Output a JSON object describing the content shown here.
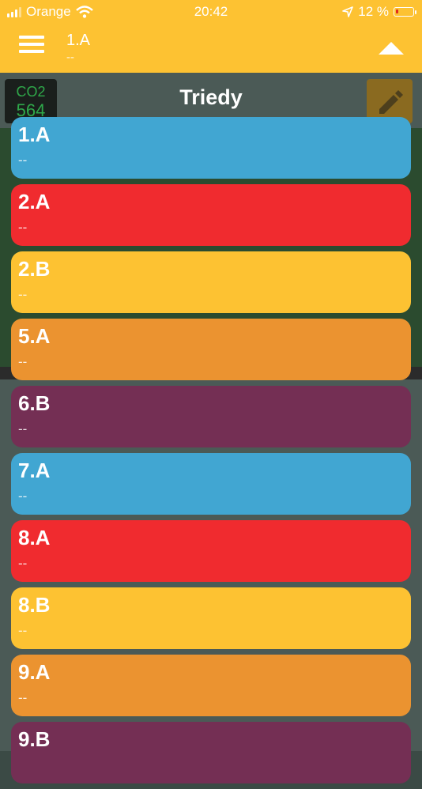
{
  "status_bar": {
    "carrier": "Orange",
    "time": "20:42",
    "battery_text": "12 %"
  },
  "header": {
    "title": "1.A",
    "subtitle": "--"
  },
  "background": {
    "co2_label": "CO2",
    "co2_value": "564",
    "title": "Triedy"
  },
  "classes": [
    {
      "label": "1.A",
      "sub": "--",
      "color": "#41a6d2"
    },
    {
      "label": "2.A",
      "sub": "--",
      "color": "#f02b2f"
    },
    {
      "label": "2.B",
      "sub": "--",
      "color": "#fdc232"
    },
    {
      "label": "5.A",
      "sub": "--",
      "color": "#eb9330"
    },
    {
      "label": "6.B",
      "sub": "--",
      "color": "#742f54"
    },
    {
      "label": "7.A",
      "sub": "--",
      "color": "#41a6d2"
    },
    {
      "label": "8.A",
      "sub": "--",
      "color": "#f02b2f"
    },
    {
      "label": "8.B",
      "sub": "--",
      "color": "#fdc232"
    },
    {
      "label": "9.A",
      "sub": "--",
      "color": "#eb9330"
    },
    {
      "label": "9.B",
      "sub": "",
      "color": "#742f54"
    }
  ]
}
